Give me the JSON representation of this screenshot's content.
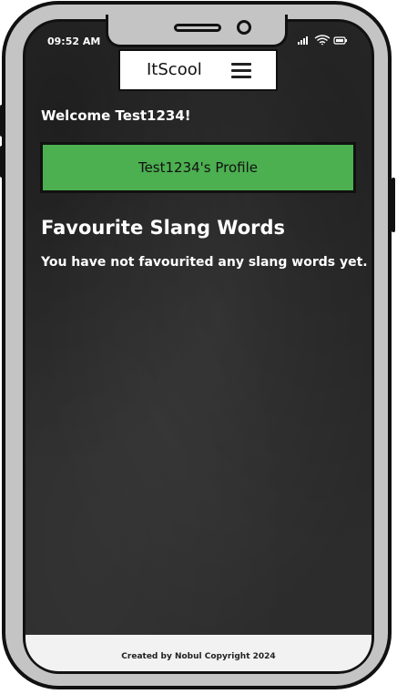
{
  "status_bar": {
    "time": "09:52 AM",
    "icons": [
      "signal-icon",
      "wifi-icon",
      "battery-icon"
    ]
  },
  "header": {
    "title": "ItScool",
    "menu_icon": "hamburger-menu-icon"
  },
  "main": {
    "welcome_text": "Welcome Test1234!",
    "profile_button_label": "Test1234's Profile",
    "section_heading": "Favourite Slang Words",
    "empty_message": "You have not favourited any slang words yet."
  },
  "footer": {
    "text": "Created by Nobul Copyright 2024"
  },
  "colors": {
    "background": "#2c2c2c",
    "profile_button": "#4caf50",
    "frame": "#c4c4c4",
    "footer": "#f2f2f2"
  }
}
